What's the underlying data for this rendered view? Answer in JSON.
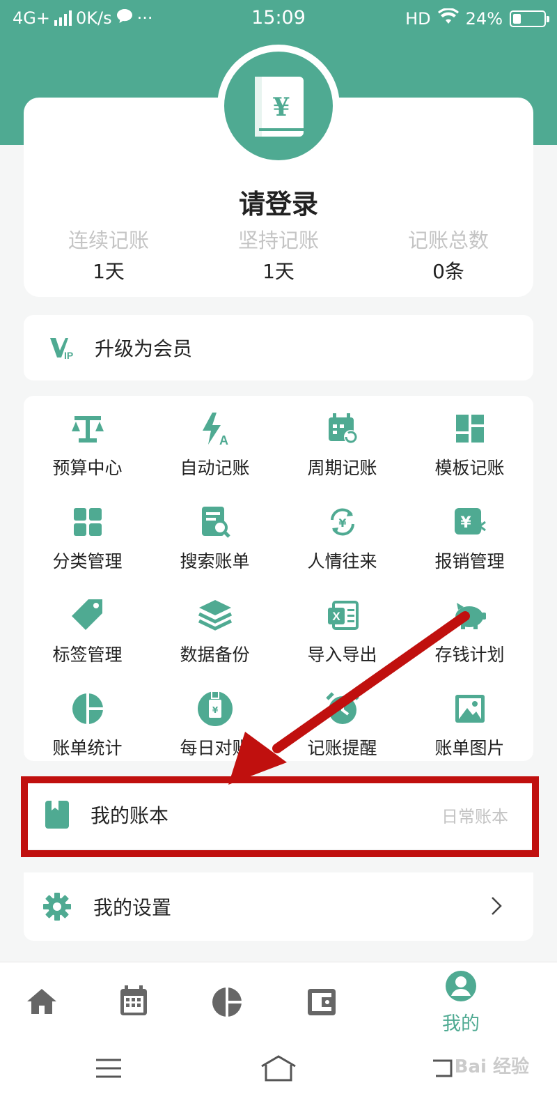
{
  "status_bar": {
    "network": "4G+",
    "speed": "0K/s",
    "time": "15:09",
    "hd": "HD",
    "battery": "24%",
    "battery_level": 0.24
  },
  "profile": {
    "login_title": "请登录",
    "stats": [
      {
        "label": "连续记账",
        "value": "1天"
      },
      {
        "label": "坚持记账",
        "value": "1天"
      },
      {
        "label": "记账总数",
        "value": "0条"
      }
    ]
  },
  "vip": {
    "label": "升级为会员"
  },
  "grid": [
    {
      "label": "预算中心",
      "icon": "scale-icon"
    },
    {
      "label": "自动记账",
      "icon": "auto-bolt-icon"
    },
    {
      "label": "周期记账",
      "icon": "calendar-repeat-icon"
    },
    {
      "label": "模板记账",
      "icon": "template-icon"
    },
    {
      "label": "分类管理",
      "icon": "category-grid-icon"
    },
    {
      "label": "搜索账单",
      "icon": "search-bill-icon"
    },
    {
      "label": "人情往来",
      "icon": "exchange-yen-icon"
    },
    {
      "label": "报销管理",
      "icon": "reimburse-icon"
    },
    {
      "label": "标签管理",
      "icon": "tag-icon"
    },
    {
      "label": "数据备份",
      "icon": "layers-icon"
    },
    {
      "label": "导入导出",
      "icon": "excel-icon"
    },
    {
      "label": "存钱计划",
      "icon": "piggy-bank-icon"
    },
    {
      "label": "账单统计",
      "icon": "pie-chart-icon"
    },
    {
      "label": "每日对账",
      "icon": "daily-check-icon"
    },
    {
      "label": "记账提醒",
      "icon": "alarm-clock-icon"
    },
    {
      "label": "账单图片",
      "icon": "image-icon"
    }
  ],
  "book": {
    "label": "我的账本",
    "value": "日常账本"
  },
  "settings": {
    "label": "我的设置"
  },
  "bottom_nav": {
    "items": [
      "home-icon",
      "calendar-icon",
      "chart-icon",
      "wallet-icon",
      "profile-icon"
    ],
    "active_label": "我的"
  },
  "watermark": "Bai 经验",
  "colors": {
    "accent": "#4faa92",
    "highlight": "#c0100e"
  }
}
